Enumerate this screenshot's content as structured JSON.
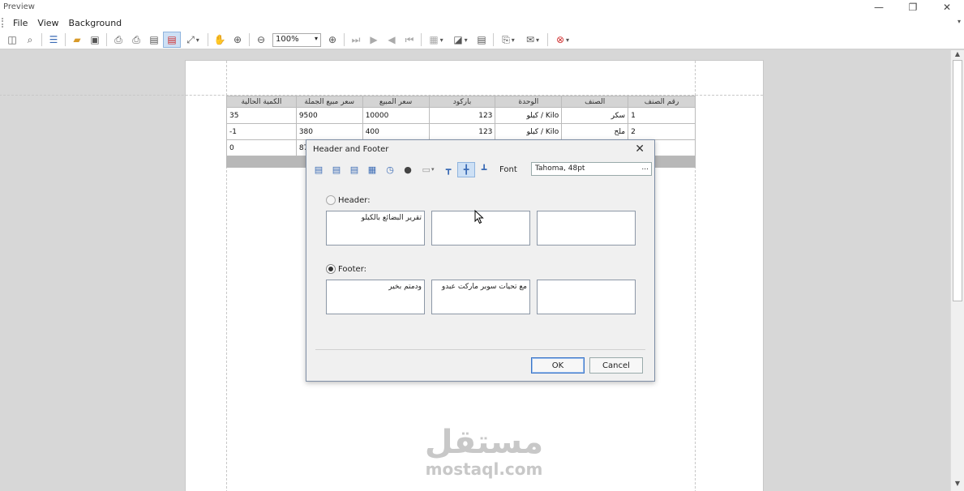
{
  "window": {
    "title": "Preview",
    "minimize_glyph": "—",
    "restore_glyph": "❐",
    "close_glyph": "✕"
  },
  "menu": {
    "items": [
      "File",
      "View",
      "Background"
    ]
  },
  "toolbar": {
    "zoom_value": "100%"
  },
  "report": {
    "headers": [
      "رقم الصنف",
      "الصنف",
      "الوحدة",
      "باركود",
      "سعر المبيع",
      "سعر مبيع الجملة",
      "الكمية الحالية"
    ],
    "rows": [
      {
        "num": "1",
        "item": "سكر",
        "unit": "كيلو / Kilo",
        "barcode": "123",
        "price": "10000",
        "wholesale": "9500",
        "qty": "35"
      },
      {
        "num": "2",
        "item": "ملح",
        "unit": "كيلو / Kilo",
        "barcode": "123",
        "price": "400",
        "wholesale": "380",
        "qty": "-1"
      },
      {
        "num": "",
        "item": "",
        "unit": "",
        "barcode": "",
        "price": "",
        "wholesale": "87",
        "qty": "0"
      }
    ]
  },
  "dialog": {
    "title": "Header and Footer",
    "font_label": "Font",
    "font_value": "Tahoma, 48pt",
    "font_button": "...",
    "header_label": "Header:",
    "footer_label": "Footer:",
    "header_boxes": [
      "تقرير البضائع بالكيلو",
      "",
      ""
    ],
    "footer_boxes": [
      "ودمتم بخير",
      "مع تحيات سوبر ماركت عبدو",
      ""
    ],
    "ok_label": "OK",
    "cancel_label": "Cancel",
    "selected_section": "footer"
  },
  "watermark": {
    "arabic": "مستقل",
    "latin": "mostaql.com"
  },
  "colors": {
    "accent": "#3b6bb5",
    "danger": "#d03030",
    "page_bg": "#d7d7d7",
    "header_bg": "#d4d4d4"
  }
}
